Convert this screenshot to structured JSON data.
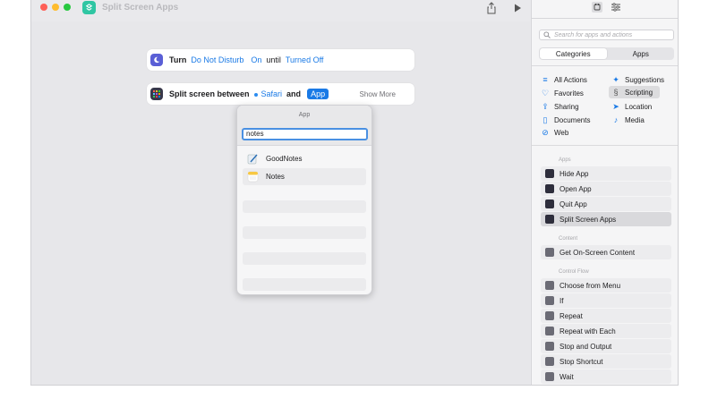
{
  "window": {
    "title": "Split Screen Apps"
  },
  "editor": {
    "action1": {
      "word_turn": "Turn",
      "token_mode": "Do Not Disturb",
      "token_state": "On",
      "word_until": "until",
      "token_until": "Turned Off"
    },
    "action2": {
      "word_split": "Split screen between",
      "token_app1": "Safari",
      "word_and": "and",
      "token_app2": "App",
      "show_more": "Show More"
    },
    "popup": {
      "title": "App",
      "input_value": "notes",
      "results": [
        {
          "label": "GoodNotes",
          "icon": "goodnotes-icon"
        },
        {
          "label": "Notes",
          "icon": "notes-icon"
        }
      ]
    }
  },
  "sidebar": {
    "search_placeholder": "Search for apps and actions",
    "tabs": [
      "Categories",
      "Apps"
    ],
    "active_tab": "Apps",
    "categories_left": [
      {
        "label": "All Actions",
        "icon": "list-icon"
      },
      {
        "label": "Favorites",
        "icon": "heart-icon"
      },
      {
        "label": "Sharing",
        "icon": "share-icon"
      },
      {
        "label": "Documents",
        "icon": "document-icon"
      },
      {
        "label": "Web",
        "icon": "compass-icon"
      }
    ],
    "categories_right": [
      {
        "label": "Suggestions",
        "icon": "sparkle-icon"
      },
      {
        "label": "Scripting",
        "icon": "scripting-icon",
        "selected": true
      },
      {
        "label": "Location",
        "icon": "location-arrow-icon"
      },
      {
        "label": "Media",
        "icon": "music-note-icon"
      }
    ],
    "sections": [
      {
        "title": "Apps",
        "actions": [
          {
            "label": "Hide App",
            "icon": "app-grid-icon"
          },
          {
            "label": "Open App",
            "icon": "app-grid-icon"
          },
          {
            "label": "Quit App",
            "icon": "app-grid-icon"
          },
          {
            "label": "Split Screen Apps",
            "icon": "app-grid-icon",
            "selected": true
          }
        ]
      },
      {
        "title": "Content",
        "actions": [
          {
            "label": "Get On-Screen Content",
            "icon": "screen-content-icon"
          }
        ]
      },
      {
        "title": "Control Flow",
        "actions": [
          {
            "label": "Choose from Menu",
            "icon": "menu-icon"
          },
          {
            "label": "If",
            "icon": "if-icon"
          },
          {
            "label": "Repeat",
            "icon": "repeat-icon"
          },
          {
            "label": "Repeat with Each",
            "icon": "repeat-each-icon"
          },
          {
            "label": "Stop and Output",
            "icon": "stop-output-icon"
          },
          {
            "label": "Stop Shortcut",
            "icon": "stop-icon"
          },
          {
            "label": "Wait",
            "icon": "clock-icon"
          }
        ]
      }
    ]
  },
  "colors": {
    "accent": "#1a7ae6",
    "app_icon": "#2fc6a3",
    "dnd_icon": "#5a5fd6"
  }
}
